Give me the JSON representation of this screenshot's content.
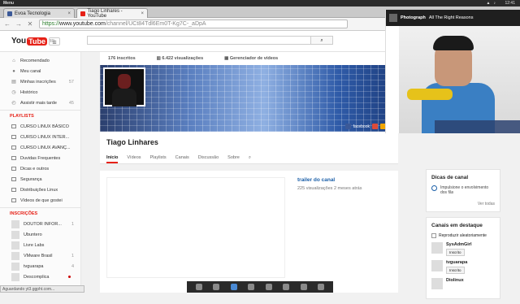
{
  "desktop": {
    "menu": "Menu",
    "clock": "12:41"
  },
  "tabs": [
    {
      "label": "Evoa Tecnologia"
    },
    {
      "label": "Tiago Linhares - YouTube"
    }
  ],
  "url": {
    "https": "https://",
    "host": "www.youtube.com",
    "path": "/channel/UCt84Tdl6Em0T-Kg7C-_aDpA"
  },
  "youtube": {
    "logo_text": "You",
    "logo_tube": "Tube",
    "country": "BR"
  },
  "sidebar": {
    "items": [
      {
        "label": "Recomendado",
        "icon": "home-icon"
      },
      {
        "label": "Meu canal",
        "icon": "user-icon"
      },
      {
        "label": "Minhas inscrições",
        "count": "57",
        "icon": "subscriptions-icon"
      },
      {
        "label": "Histórico",
        "icon": "history-icon"
      },
      {
        "label": "Assistir mais tarde",
        "count": "45",
        "icon": "clock-icon"
      }
    ],
    "playlists_heading": "PLAYLISTS",
    "playlists": [
      "CURSO LINUX BÁSICO",
      "CURSO LINUX INTER...",
      "CURSO LINUX AVANÇ...",
      "Duvidas Frequentes",
      "Dicas e outros",
      "Segurança",
      "Distribuições Linux",
      "Vídeos de que gostei"
    ],
    "subs_heading": "INSCRIÇÕES",
    "subscriptions": [
      {
        "label": "DOUTOR INFOR...",
        "count": "1"
      },
      {
        "label": "Ubuntero",
        "count": ""
      },
      {
        "label": "Livre Labs",
        "count": ""
      },
      {
        "label": "VMware Brasil",
        "count": "1"
      },
      {
        "label": "tvguarapa",
        "count": "4"
      },
      {
        "label": "Descomplica",
        "count": "",
        "dot": true
      }
    ]
  },
  "status": "Aguardando yt3.ggpht.com...",
  "channel": {
    "subscribers": "176 inscritos",
    "views": "6.422 visualizações",
    "manager": "Gerenciador de vídeos",
    "name": "Tiago Linhares",
    "tabs": [
      "Início",
      "Vídeos",
      "Playlists",
      "Canais",
      "Discussão",
      "Sobre"
    ],
    "trailer_title": "trailer do canal",
    "trailer_meta": "225 visualizações  2 meses atrás",
    "social": "facebook"
  },
  "right": {
    "tips_title": "Dicas de canal",
    "tip_text": "Impulsione o envolvimento dos fãs",
    "see_all": "Ver todas",
    "featured_title": "Canais em destaque",
    "shuffle": "Reproduzir aleatoriamente",
    "featured": [
      {
        "name": "SysAdmGirl",
        "btn": "Inscrito"
      },
      {
        "name": "tvguarapa",
        "btn": "Inscrito"
      },
      {
        "name": "Diolinux",
        "btn": ""
      }
    ]
  },
  "webcam": {
    "title": "Photograph",
    "artist": "All The Right Reasons"
  }
}
